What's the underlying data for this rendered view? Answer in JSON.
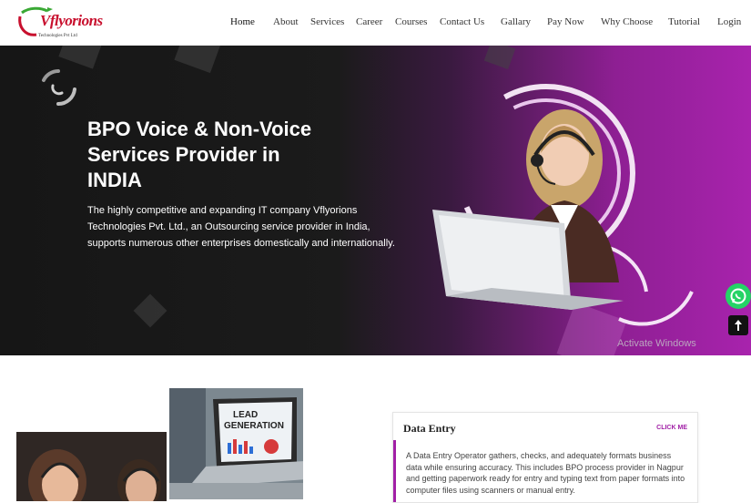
{
  "brand": {
    "logo_text": "Vflyorions",
    "logo_sub": "Technologies Pvt Ltd"
  },
  "nav": {
    "items": [
      "Home",
      "About",
      "Services",
      "Career",
      "Courses",
      "Contact Us",
      "Gallary",
      "Pay Now",
      "Why Choose",
      "Tutorial",
      "Login"
    ]
  },
  "hero": {
    "title_line1": "BPO Voice & Non-Voice",
    "title_line2": "Services Provider in",
    "title_line3": "INDIA",
    "text_line1": "The highly competitive and expanding IT company Vflyorions",
    "text_line2": "Technologies Pvt. Ltd., an Outsourcing service provider in India,",
    "text_line3": "supports numerous other enterprises domestically and internationally."
  },
  "watermark": "Activate Windows",
  "photo": {
    "lead_line1": "LEAD",
    "lead_line2": "GENERATION"
  },
  "card": {
    "title": "Data Entry",
    "click": "CLICK ME",
    "text_line1": "A Data Entry Operator gathers, checks, and adequately formats business",
    "text_line2": "data while ensuring accuracy. This includes BPO process provider in Nagpur",
    "text_line3": "and getting paperwork ready for entry and typing text from paper formats into",
    "text_line4": "computer files using scanners or manual entry."
  },
  "colors": {
    "accent": "#a11fa6",
    "whatsapp": "#25d366"
  }
}
